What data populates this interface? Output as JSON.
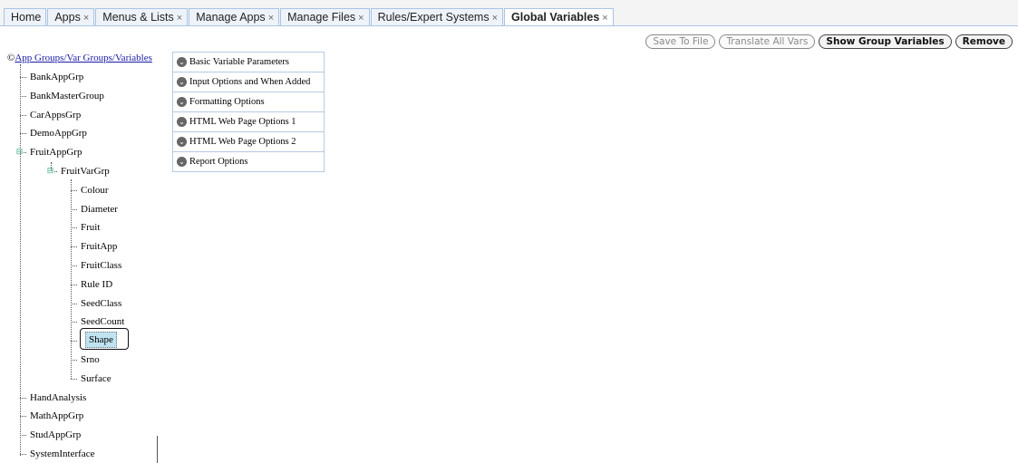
{
  "tabs": [
    {
      "label": "Home",
      "closable": false
    },
    {
      "label": "Apps",
      "closable": true
    },
    {
      "label": "Menus & Lists",
      "closable": true
    },
    {
      "label": "Manage Apps",
      "closable": true
    },
    {
      "label": "Manage Files",
      "closable": true
    },
    {
      "label": "Rules/Expert Systems",
      "closable": true
    },
    {
      "label": "Global Variables",
      "closable": true,
      "active": true
    }
  ],
  "tab_close_glyph": "×",
  "actions": {
    "save_to_file": "Save To File",
    "translate_all": "Translate All Vars",
    "show_group_vars": "Show Group Variables",
    "remove": "Remove"
  },
  "tree": {
    "root_label": "App Groups/Var Groups/Variables",
    "root_icon": "©",
    "groups_before": [
      "BankAppGrp",
      "BankMasterGroup",
      "CarAppsGrp",
      "DemoAppGrp"
    ],
    "expanded_group": "FruitAppGrp",
    "var_group": "FruitVarGrp",
    "variables": [
      "Colour",
      "Diameter",
      "Fruit",
      "FruitApp",
      "FruitClass",
      "Rule ID",
      "SeedClass",
      "SeedCount",
      "Shape",
      "Srno",
      "Surface"
    ],
    "selected_variable": "Shape",
    "groups_after": [
      "HandAnalysis",
      "MathAppGrp",
      "StudAppGrp",
      "SystemInterface"
    ],
    "expander_glyph": "⊟"
  },
  "accordion": [
    "Basic Variable Parameters",
    "Input Options and When Added",
    "Formatting Options",
    "HTML Web Page Options 1",
    "HTML Web Page Options 2",
    "Report Options"
  ],
  "accordion_icon_glyph": "⌄",
  "colors": {
    "accent_border": "#a9c4e4",
    "selected_bg": "#bfe3f0",
    "link": "#1a1aa6"
  }
}
